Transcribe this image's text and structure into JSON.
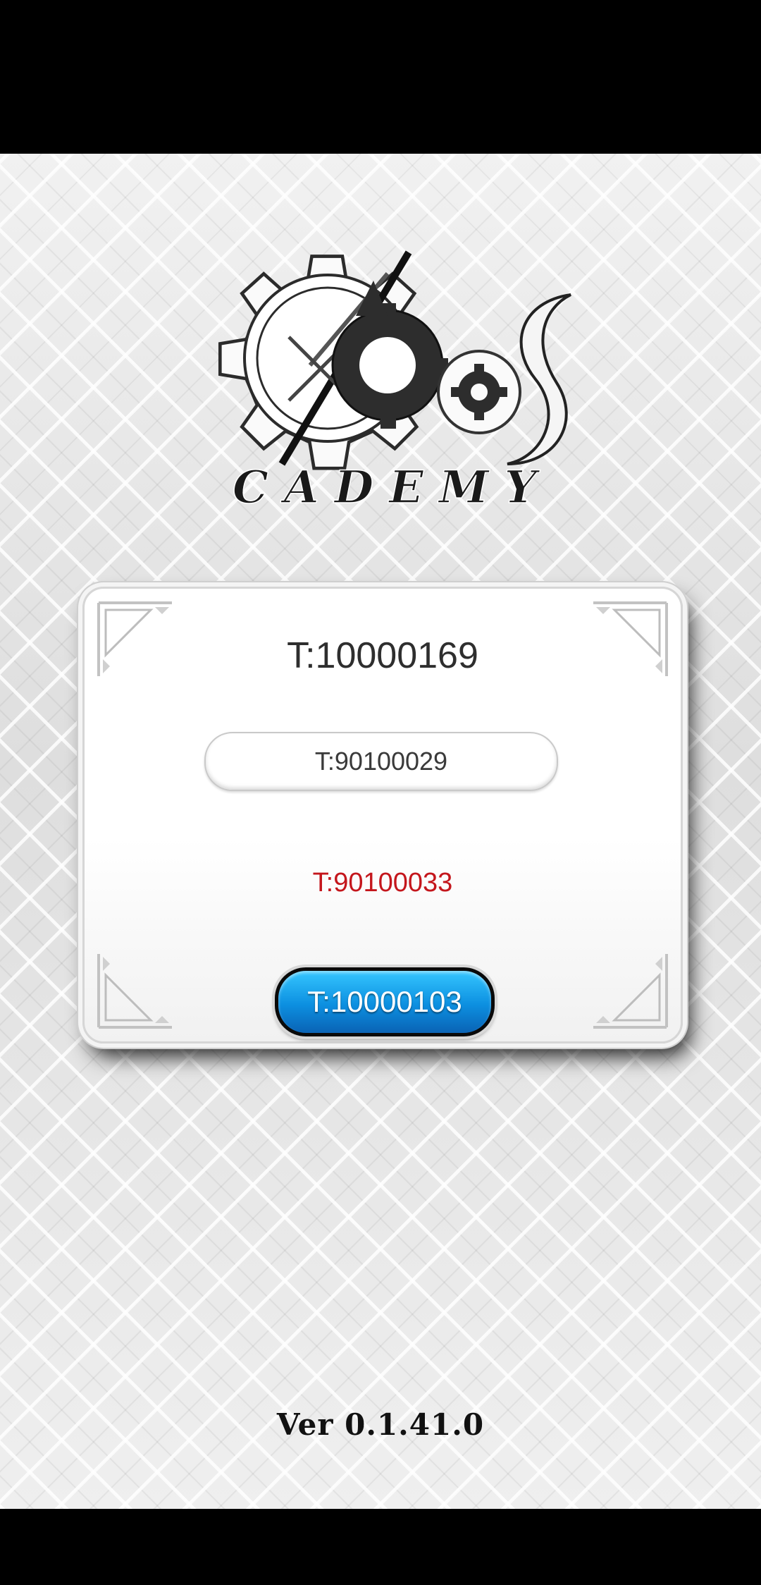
{
  "logo": {
    "wordmark": "CADEMY"
  },
  "dialog": {
    "title": "T:10000169",
    "field_text": "T:90100029",
    "message": "T:90100033",
    "button_label": "T:10000103"
  },
  "footer": {
    "version": "Ver 0.1.41.0"
  },
  "colors": {
    "button": "#0c8fe0",
    "message": "#c4161c"
  }
}
